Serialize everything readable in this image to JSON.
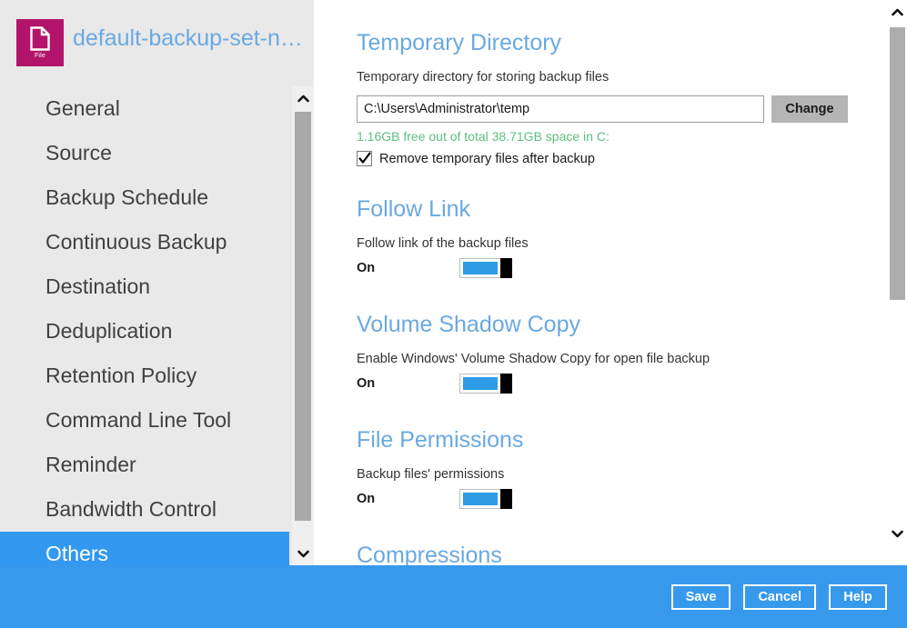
{
  "header": {
    "icon_name": "file-document-icon",
    "icon_caption": "File",
    "title": "default-backup-set-n…"
  },
  "sidebar": {
    "items": [
      {
        "label": "General",
        "selected": false
      },
      {
        "label": "Source",
        "selected": false
      },
      {
        "label": "Backup Schedule",
        "selected": false
      },
      {
        "label": "Continuous Backup",
        "selected": false
      },
      {
        "label": "Destination",
        "selected": false
      },
      {
        "label": "Deduplication",
        "selected": false
      },
      {
        "label": "Retention Policy",
        "selected": false
      },
      {
        "label": "Command Line Tool",
        "selected": false
      },
      {
        "label": "Reminder",
        "selected": false
      },
      {
        "label": "Bandwidth Control",
        "selected": false
      },
      {
        "label": "Others",
        "selected": true
      }
    ]
  },
  "main": {
    "temporary_directory": {
      "title": "Temporary Directory",
      "description": "Temporary directory for storing backup files",
      "path_value": "C:\\Users\\Administrator\\temp",
      "change_label": "Change",
      "disk_space": "1.16GB free out of total 38.71GB space in C:",
      "remove_temp_label": "Remove temporary files after backup",
      "remove_temp_checked": true
    },
    "follow_link": {
      "title": "Follow Link",
      "description": "Follow link of the backup files",
      "state": "On"
    },
    "volume_shadow_copy": {
      "title": "Volume Shadow Copy",
      "description": "Enable Windows' Volume Shadow Copy for open file backup",
      "state": "On"
    },
    "file_permissions": {
      "title": "File Permissions",
      "description": "Backup files' permissions",
      "state": "On"
    },
    "compressions": {
      "title": "Compressions"
    }
  },
  "footer": {
    "save_label": "Save",
    "cancel_label": "Cancel",
    "help_label": "Help"
  },
  "colors": {
    "accent_blue": "#3799ec",
    "heading_blue": "#6aa9e0",
    "icon_magenta": "#b3146b",
    "disk_green": "#5cbf7f",
    "toggle_blue": "#2e9be5"
  }
}
